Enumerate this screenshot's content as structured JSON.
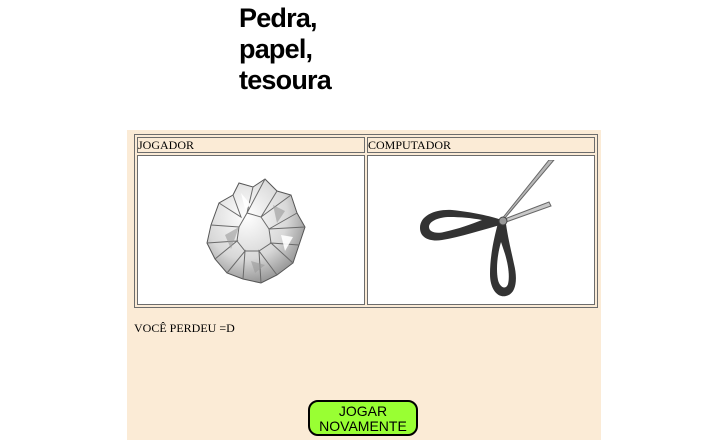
{
  "title_lines": [
    "Pedra,",
    "papel,",
    "tesoura"
  ],
  "table": {
    "player_header": "JOGADOR",
    "computer_header": "COMPUTADOR",
    "player_choice": {
      "name": "papel",
      "icon": "crumpled-paper-icon"
    },
    "computer_choice": {
      "name": "tesoura",
      "icon": "scissors-icon"
    }
  },
  "result": "VOCÊ PERDEU =D",
  "button": {
    "line1": "JOGAR",
    "line2": "NOVAMENTE"
  },
  "colors": {
    "panel_bg": "#fbebd6",
    "button_bg": "#99ff33",
    "border": "#6c6c6c"
  }
}
